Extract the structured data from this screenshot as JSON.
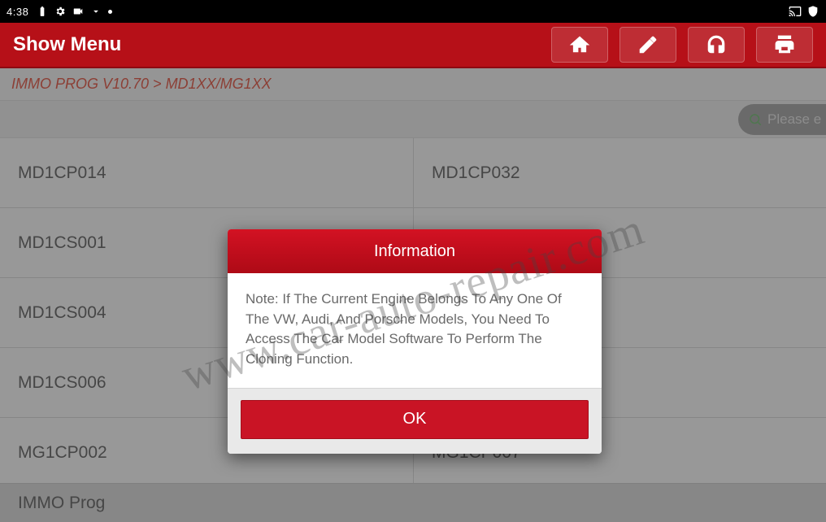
{
  "status_bar": {
    "time": "4:38"
  },
  "header": {
    "title": "Show Menu"
  },
  "breadcrumb": "IMMO PROG V10.70 > MD1XX/MG1XX",
  "search": {
    "placeholder": "Please e"
  },
  "list": {
    "left": [
      "MD1CP014",
      "MD1CS001",
      "MD1CS004",
      "MD1CS006",
      "MG1CP002"
    ],
    "right": [
      "MD1CP032",
      "",
      "",
      "",
      "MG1CP007"
    ]
  },
  "bottom_label": "IMMO Prog",
  "dialog": {
    "title": "Information",
    "body": "Note: If The Current Engine Belongs To Any One Of The VW, Audi, And Porsche Models, You Need To Access The Car Model Software To Perform The Cloning Function.",
    "ok_label": "OK"
  },
  "watermark": "www.car-auto-repair.com"
}
